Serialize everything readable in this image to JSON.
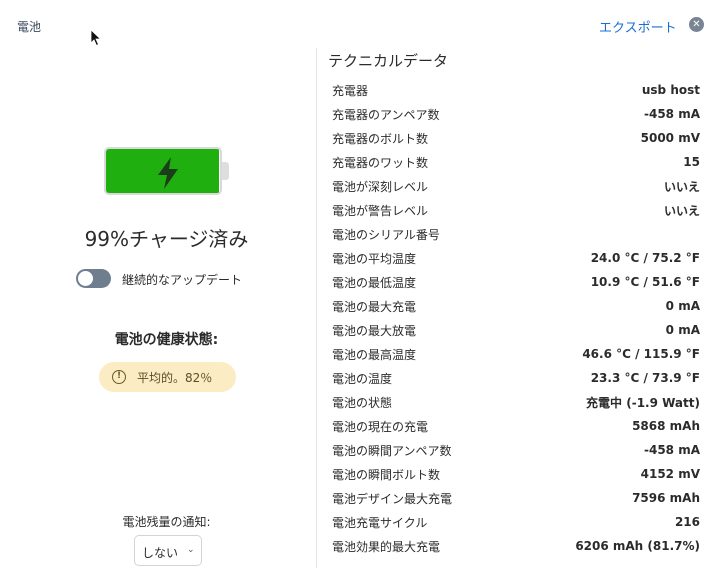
{
  "header": {
    "title": "電池",
    "export_label": "エクスポート",
    "close_symbol": "✕"
  },
  "battery": {
    "level_percent": 99,
    "charging": true,
    "fill_color": "#1fb00f",
    "status_text": "99%チャージ済み"
  },
  "auto_update": {
    "label": "継続的なアップデート",
    "enabled": false
  },
  "health": {
    "title": "電池の健康状態:",
    "value_text": "平均的。82％",
    "icon": "warning-circle-icon"
  },
  "notification": {
    "label": "電池残量の通知:",
    "selected": "しない"
  },
  "technical": {
    "title": "テクニカルデータ",
    "rows": [
      {
        "label": "充電器",
        "value": "usb host"
      },
      {
        "label": "充電器のアンペア数",
        "value": "-458 mA"
      },
      {
        "label": "充電器のボルト数",
        "value": "5000 mV"
      },
      {
        "label": "充電器のワット数",
        "value": "15"
      },
      {
        "label": "電池が深刻レベル",
        "value": "いいえ"
      },
      {
        "label": "電池が警告レベル",
        "value": "いいえ"
      },
      {
        "label": "電池のシリアル番号",
        "value": ""
      },
      {
        "label": "電池の平均温度",
        "value": "24.0 °C / 75.2 °F"
      },
      {
        "label": "電池の最低温度",
        "value": "10.9 °C / 51.6 °F"
      },
      {
        "label": "電池の最大充電",
        "value": "0 mA"
      },
      {
        "label": "電池の最大放電",
        "value": "0 mA"
      },
      {
        "label": "電池の最高温度",
        "value": "46.6 °C / 115.9 °F"
      },
      {
        "label": "電池の温度",
        "value": "23.3 °C / 73.9 °F"
      },
      {
        "label": "電池の状態",
        "value": "充電中 (-1.9 Watt)"
      },
      {
        "label": "電池の現在の充電",
        "value": "5868 mAh"
      },
      {
        "label": "電池の瞬間アンペア数",
        "value": "-458 mA"
      },
      {
        "label": "電池の瞬間ボルト数",
        "value": "4152 mV"
      },
      {
        "label": "電池デザイン最大充電",
        "value": "7596 mAh"
      },
      {
        "label": "電池充電サイクル",
        "value": "216"
      },
      {
        "label": "電池効果的最大充電",
        "value": "6206 mAh (81.7%)"
      }
    ]
  }
}
